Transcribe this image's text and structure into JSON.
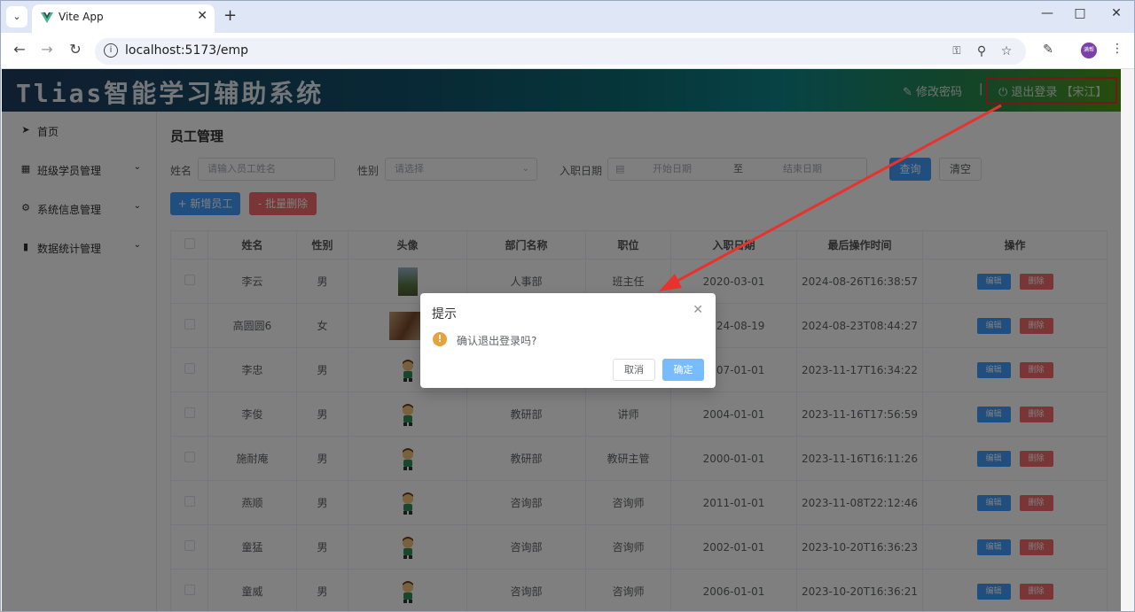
{
  "browser": {
    "tab_title": "Vite App",
    "url": "localhost:5173/emp",
    "avatar_text": "满帮"
  },
  "app": {
    "title": "Tlias智能学习辅助系统",
    "change_password": "修改密码",
    "separator": "|",
    "logout": "退出登录 【宋江】"
  },
  "sidebar": {
    "items": [
      {
        "label": "首页",
        "icon": "paper-plane-icon"
      },
      {
        "label": "班级学员管理",
        "icon": "grid-icon"
      },
      {
        "label": "系统信息管理",
        "icon": "gear-icon"
      },
      {
        "label": "数据统计管理",
        "icon": "bar-chart-icon"
      }
    ]
  },
  "page": {
    "title": "员工管理",
    "filters": {
      "name_label": "姓名",
      "name_placeholder": "请输入员工姓名",
      "gender_label": "性别",
      "gender_placeholder": "请选择",
      "date_label": "入职日期",
      "start_placeholder": "开始日期",
      "range_sep": "至",
      "end_placeholder": "结束日期",
      "query": "查询",
      "clear": "清空"
    },
    "actions": {
      "add": "+ 新增员工",
      "batch_delete": "- 批量删除"
    },
    "table": {
      "headers": [
        "姓名",
        "性别",
        "头像",
        "部门名称",
        "职位",
        "入职日期",
        "最后操作时间",
        "操作"
      ],
      "edit": "编辑",
      "delete": "删除",
      "rows": [
        {
          "name": "李云",
          "gender": "男",
          "dept": "人事部",
          "job": "班主任",
          "entry": "2020-03-01",
          "updated": "2024-08-26T16:38:57"
        },
        {
          "name": "高圆圆6",
          "gender": "女",
          "dept": "",
          "job": "",
          "entry": "2024-08-19",
          "updated": "2024-08-23T08:44:27"
        },
        {
          "name": "李忠",
          "gender": "男",
          "dept": "",
          "job": "",
          "entry": "2007-01-01",
          "updated": "2023-11-17T16:34:22"
        },
        {
          "name": "李俊",
          "gender": "男",
          "dept": "教研部",
          "job": "讲师",
          "entry": "2004-01-01",
          "updated": "2023-11-16T17:56:59"
        },
        {
          "name": "施耐庵",
          "gender": "男",
          "dept": "教研部",
          "job": "教研主管",
          "entry": "2000-01-01",
          "updated": "2023-11-16T16:11:26"
        },
        {
          "name": "燕顺",
          "gender": "男",
          "dept": "咨询部",
          "job": "咨询师",
          "entry": "2011-01-01",
          "updated": "2023-11-08T22:12:46"
        },
        {
          "name": "童猛",
          "gender": "男",
          "dept": "咨询部",
          "job": "咨询师",
          "entry": "2002-01-01",
          "updated": "2023-10-20T16:36:23"
        },
        {
          "name": "童威",
          "gender": "男",
          "dept": "咨询部",
          "job": "咨询师",
          "entry": "2006-01-01",
          "updated": "2023-10-20T16:36:21"
        }
      ]
    }
  },
  "dialog": {
    "title": "提示",
    "message": "确认退出登录吗?",
    "cancel": "取消",
    "confirm": "确定"
  },
  "colors": {
    "primary": "#409eff",
    "danger": "#f56c6c",
    "warning": "#e6a23c",
    "annotation": "#e8322d"
  }
}
